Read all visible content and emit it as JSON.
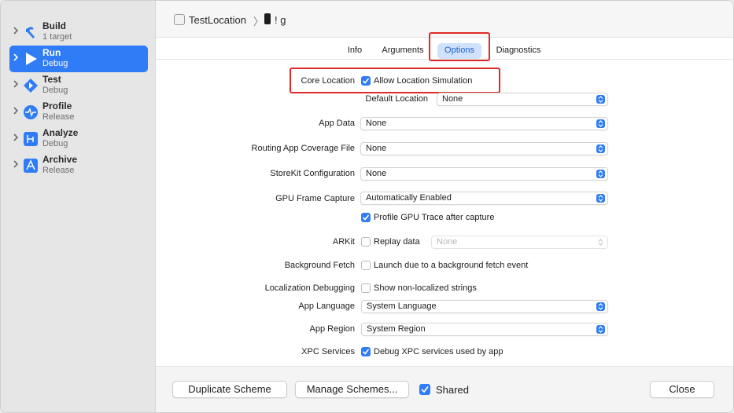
{
  "sidebar": {
    "items": [
      {
        "title": "Build",
        "subtitle": "1 target",
        "icon": "hammer-icon",
        "active": false
      },
      {
        "title": "Run",
        "subtitle": "Debug",
        "icon": "play-icon",
        "active": true
      },
      {
        "title": "Test",
        "subtitle": "Debug",
        "icon": "test-diamond-icon",
        "active": false
      },
      {
        "title": "Profile",
        "subtitle": "Release",
        "icon": "instruments-icon",
        "active": false
      },
      {
        "title": "Analyze",
        "subtitle": "Debug",
        "icon": "analyze-icon",
        "active": false
      },
      {
        "title": "Archive",
        "subtitle": "Release",
        "icon": "archive-icon",
        "active": false
      }
    ]
  },
  "breadcrumb": {
    "scheme": "TestLocation",
    "separator": "〉",
    "destination": "! ɡ"
  },
  "tabs": [
    "Info",
    "Arguments",
    "Options",
    "Diagnostics"
  ],
  "selected_tab": "Options",
  "options": {
    "core_location": {
      "label": "Core Location",
      "checkbox": "Allow Location Simulation",
      "checked": true
    },
    "default_location": {
      "label": "Default Location",
      "value": "None"
    },
    "app_data": {
      "label": "App Data",
      "value": "None"
    },
    "routing": {
      "label": "Routing App Coverage File",
      "value": "None"
    },
    "storekit": {
      "label": "StoreKit Configuration",
      "value": "None"
    },
    "gpu": {
      "label": "GPU Frame Capture",
      "value": "Automatically Enabled"
    },
    "gpu_trace": {
      "checkbox": "Profile GPU Trace after capture",
      "checked": true
    },
    "arkit": {
      "label": "ARKit",
      "checkbox": "Replay data",
      "checked": false,
      "value": "None"
    },
    "bg_fetch": {
      "label": "Background Fetch",
      "checkbox": "Launch due to a background fetch event",
      "checked": false
    },
    "localization": {
      "label": "Localization Debugging",
      "checkbox": "Show non-localized strings",
      "checked": false
    },
    "app_language": {
      "label": "App Language",
      "value": "System Language"
    },
    "app_region": {
      "label": "App Region",
      "value": "System Region"
    },
    "xpc": {
      "label": "XPC Services",
      "checkbox": "Debug XPC services used by app",
      "checked": true
    }
  },
  "footer": {
    "duplicate": "Duplicate Scheme",
    "manage": "Manage Schemes...",
    "shared": "Shared",
    "shared_checked": true,
    "close": "Close"
  },
  "colors": {
    "accent": "#2f7cf6",
    "highlight": "#e02a2a"
  }
}
